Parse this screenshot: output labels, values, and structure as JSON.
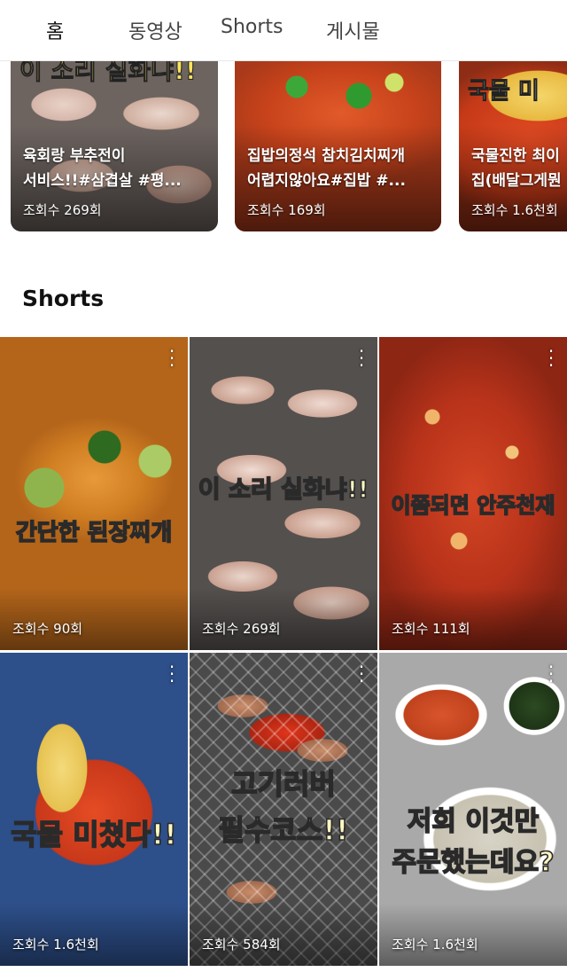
{
  "tabs": [
    {
      "label": "홈",
      "active": true
    },
    {
      "label": "동영상",
      "active": false
    },
    {
      "label": "Shorts",
      "active": false
    },
    {
      "label": "게시물",
      "active": false
    }
  ],
  "videos": [
    {
      "overlay_text": "이 소리 실화냐!!",
      "title": "육회랑 부추전이\n서비스!!#삼겹살 #평...",
      "views": "조회수 269회"
    },
    {
      "overlay_text": "",
      "title": "집밥의정석 참치김치찌개\n어렵지않아요#집밥 #...",
      "views": "조회수 169회"
    },
    {
      "overlay_text": "국물 미",
      "title": "국물진한 최이\n집(배달그게뭔",
      "views": "조회수 1.6천회"
    }
  ],
  "section": {
    "title": "Shorts"
  },
  "shorts": [
    {
      "caption": "간단한 된장찌개",
      "views": "조회수 90회"
    },
    {
      "caption": "이 소리 실화냐!!",
      "views": "조회수 269회"
    },
    {
      "caption": "이쯤되면 안주천재",
      "views": "조회수 111회"
    },
    {
      "caption": "국물 미쳤다!!",
      "views": "조회수 1.6천회"
    },
    {
      "caption": "고기러버\n필수코스!!",
      "views": "조회수 584회"
    },
    {
      "caption": "저희 이것만\n주문했는데요?",
      "views": "조회수 1.6천회"
    }
  ],
  "icons": {
    "short_menu": "more-vertical-icon"
  },
  "colors": {
    "active_tab": "#111111",
    "inactive_tab": "#444444",
    "caption_fill": "#fff7c2"
  }
}
